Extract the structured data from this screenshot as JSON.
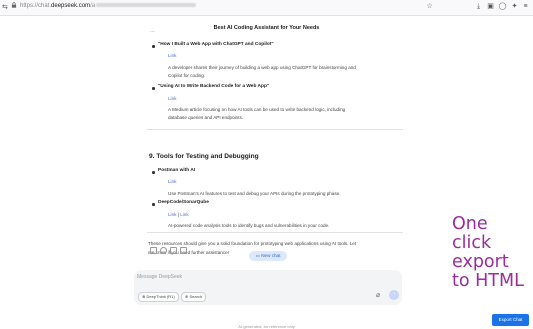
{
  "browser": {
    "url_prefix": "https://chat.",
    "url_domain": "deepseek.com",
    "url_tail": "/a"
  },
  "document": {
    "title": "Best AI Coding Assistant for Your Needs",
    "top_fragment": "…",
    "section8_items": [
      {
        "title": "\"How I Built a Web App with ChatGPT and Copilot\"",
        "link": "Link",
        "desc_lines": [
          "A developer shares their journey of building a web app using ChatGPT for brainstorming and",
          "Copilot for coding."
        ]
      },
      {
        "title": "\"Using AI to Write Backend Code for a Web App\"",
        "link": "Link",
        "desc_lines": [
          "A Medium article focusing on how AI tools can be used to write backend logic, including",
          "database queries and API endpoints."
        ]
      }
    ],
    "section9": {
      "heading": "9. Tools for Testing and Debugging",
      "items": [
        {
          "title": "Postman with AI",
          "links": [
            "Link"
          ],
          "desc_lines": [
            "Use Postman's AI features to test and debug your APIs during the prototyping phase."
          ]
        },
        {
          "title": "DeepCode/SonarQube",
          "links": [
            "Link",
            "Link"
          ],
          "link_sep": " | ",
          "desc_lines": [
            "AI-powered code analysis tools to identify bugs and vulnerabilities in your code."
          ]
        }
      ]
    },
    "closing_lines": [
      "These resources should give you a solid foundation for prototyping web applications using AI tools. Let",
      "me know if you need further assistance!"
    ]
  },
  "chat": {
    "new_chat_label": "New chat",
    "input_placeholder": "Message DeepSeek",
    "deepthink_label": "DeepThink (R1)",
    "search_label": "Search",
    "footnote": "AI-generated, for reference only"
  },
  "overlay_text": [
    "One",
    "click",
    "export",
    "to HTML"
  ],
  "export_button": "Export Chat",
  "colors": {
    "overlay": "#9b2c9b",
    "export_button": "#1a73e8",
    "link": "#4b6bd6",
    "new_chat_bg": "#dbe8fe"
  },
  "icons": [
    "tune-icon",
    "lock-icon",
    "star-icon",
    "download-icon",
    "save-icon",
    "account-icon",
    "extensions-icon",
    "menu-icon",
    "copy-icon",
    "regenerate-icon",
    "thumbs-up-icon",
    "thumbs-down-icon",
    "new-chat-icon",
    "deepthink-icon",
    "globe-icon",
    "paperclip-icon",
    "send-icon"
  ]
}
